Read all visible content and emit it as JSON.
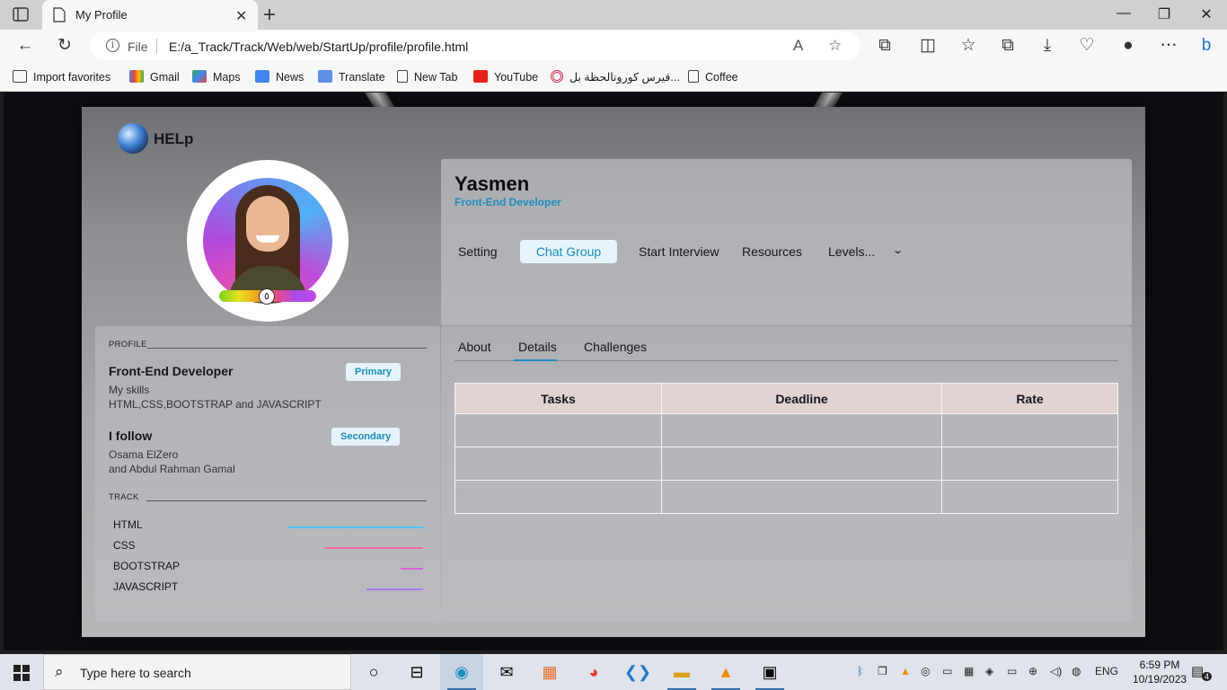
{
  "browser": {
    "tab_title": "My Profile",
    "address_scheme": "File",
    "address_url": "E:/a_Track/Track/Web/web/StartUp/profile/profile.html",
    "favorites": [
      {
        "label": "Import favorites",
        "icon": "import-icon"
      },
      {
        "label": "Gmail",
        "icon": "gmail-icon"
      },
      {
        "label": "Maps",
        "icon": "maps-icon"
      },
      {
        "label": "News",
        "icon": "news-icon"
      },
      {
        "label": "Translate",
        "icon": "translate-icon"
      },
      {
        "label": "New Tab",
        "icon": "page-icon"
      },
      {
        "label": "YouTube",
        "icon": "youtube-icon"
      },
      {
        "label": "فيرس كورونالحظة بل...",
        "icon": "target-icon"
      },
      {
        "label": "Coffee",
        "icon": "page-icon"
      }
    ]
  },
  "page": {
    "brand": "HELp",
    "rank_badge": "٥",
    "user": {
      "name": "Yasmen",
      "role": "Front-End Developer"
    },
    "menu": [
      {
        "label": "Setting"
      },
      {
        "label": "Chat Group",
        "active": true
      },
      {
        "label": "Start Interview"
      },
      {
        "label": "Resources"
      },
      {
        "label": "Levels..."
      }
    ],
    "profile": {
      "section_label": "PROFILE",
      "primary": {
        "title": "Front-End Developer",
        "badge": "Primary",
        "line1": "My skills",
        "line2": "HTML,CSS,BOOTSTRAP and JAVASCRIPT"
      },
      "secondary": {
        "title": "I follow",
        "badge": "Secondary",
        "line1": "Osama ElZero",
        "line2": "and Abdul Rahman Gamal"
      },
      "track_label": "TRACK",
      "tracks": [
        {
          "name": "HTML",
          "level": 0.6,
          "color": "#4fc3f7"
        },
        {
          "name": "CSS",
          "level": 0.44,
          "color": "#f06aa8"
        },
        {
          "name": "BOOTSTRAP",
          "level": 0.1,
          "color": "#e05fd8"
        },
        {
          "name": "JAVASCRIPT",
          "level": 0.25,
          "color": "#a77bff"
        }
      ]
    },
    "details": {
      "tabs": [
        {
          "label": "About"
        },
        {
          "label": "Details",
          "active": true
        },
        {
          "label": "Challenges"
        }
      ],
      "table_headers": [
        "Tasks",
        "Deadline",
        "Rate"
      ],
      "table_rows": [
        [
          "",
          "",
          ""
        ],
        [
          "",
          "",
          ""
        ],
        [
          "",
          "",
          ""
        ]
      ]
    }
  },
  "taskbar": {
    "search_placeholder": "Type here to search",
    "language": "ENG",
    "time": "6:59 PM",
    "date": "10/19/2023",
    "notification_count": "4"
  }
}
